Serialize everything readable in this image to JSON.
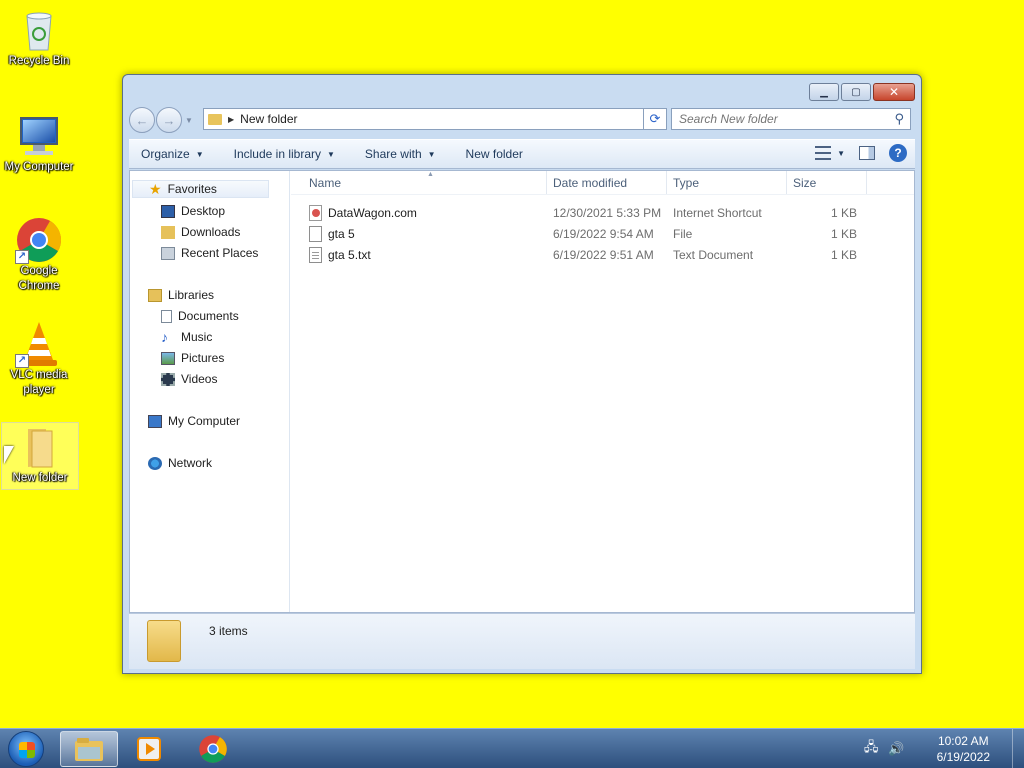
{
  "desktop": {
    "icons": [
      {
        "label": "Recycle Bin"
      },
      {
        "label": "My Computer"
      },
      {
        "label": "Google Chrome"
      },
      {
        "label": "VLC media player"
      },
      {
        "label": "New folder"
      }
    ]
  },
  "window": {
    "address": "New folder",
    "search_placeholder": "Search New folder",
    "toolbar": {
      "organize": "Organize",
      "include_in_library": "Include in library",
      "share_with": "Share with",
      "new_folder": "New folder"
    },
    "nav": {
      "favorites": "Favorites",
      "desktop": "Desktop",
      "downloads": "Downloads",
      "recent_places": "Recent Places",
      "libraries": "Libraries",
      "documents": "Documents",
      "music": "Music",
      "pictures": "Pictures",
      "videos": "Videos",
      "my_computer": "My Computer",
      "network": "Network"
    },
    "columns": {
      "name": "Name",
      "date_modified": "Date modified",
      "type": "Type",
      "size": "Size"
    },
    "files": [
      {
        "name": "DataWagon.com",
        "date": "12/30/2021 5:33 PM",
        "type": "Internet Shortcut",
        "size": "1 KB"
      },
      {
        "name": "gta 5",
        "date": "6/19/2022 9:54 AM",
        "type": "File",
        "size": "1 KB"
      },
      {
        "name": "gta 5.txt",
        "date": "6/19/2022 9:51 AM",
        "type": "Text Document",
        "size": "1 KB"
      }
    ],
    "status": "3 items"
  },
  "taskbar": {
    "time": "10:02 AM",
    "date": "6/19/2022"
  },
  "colors": {
    "desktop_bg": "#ffff00",
    "accent": "#2d6bc4"
  }
}
